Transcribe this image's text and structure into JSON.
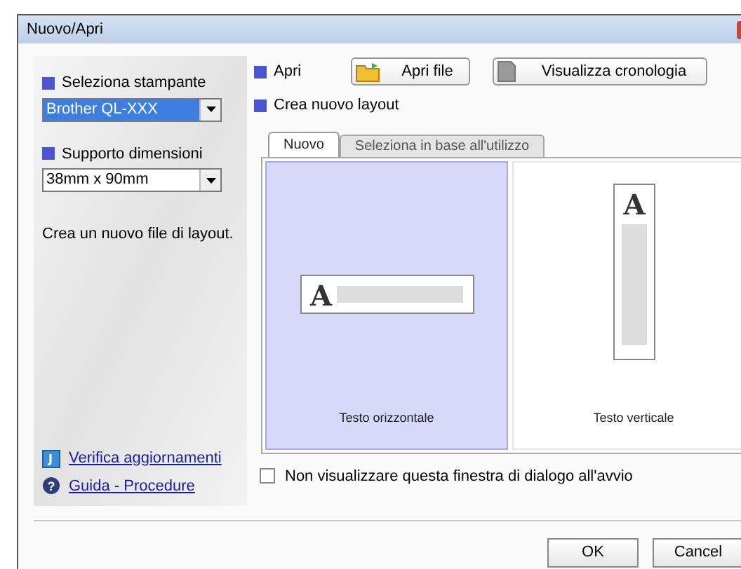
{
  "window": {
    "title": "Nuovo/Apri"
  },
  "printer": {
    "label": "Seleziona stampante",
    "value": "Brother QL-XXX"
  },
  "media": {
    "label": "Supporto dimensioni",
    "value": "38mm x 90mm"
  },
  "description": "Crea un nuovo file di layout.",
  "links": [
    {
      "kind": "update",
      "label": "Verifica aggiornamenti"
    },
    {
      "kind": "help",
      "icon_text": "?",
      "label": "Guida - Procedure"
    }
  ],
  "open": {
    "label": "Apri",
    "buttons": [
      {
        "kind": "folder",
        "label": "Apri file"
      },
      {
        "kind": "history",
        "label": "Visualizza cronologia"
      }
    ]
  },
  "create_label": "Crea nuovo layout",
  "tabs": [
    {
      "label": "Nuovo",
      "selected": true
    },
    {
      "label": "Seleziona in base all'utilizzo",
      "selected": false
    }
  ],
  "templates": [
    {
      "kind": "horizontal",
      "glyph": "A",
      "label": "Testo orizzontale",
      "selected": true
    },
    {
      "kind": "vertical",
      "glyph": "A",
      "label": "Testo verticale",
      "selected": false
    }
  ],
  "checkbox": {
    "label": "Non visualizzare questa finestra di dialogo all'avvio",
    "checked": false
  },
  "buttons": [
    "OK",
    "Cancel"
  ]
}
